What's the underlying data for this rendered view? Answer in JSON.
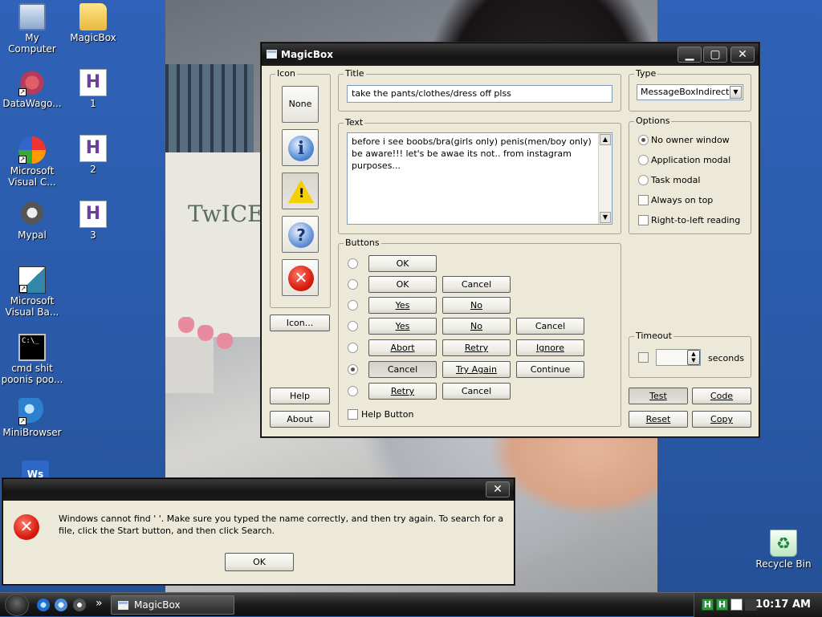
{
  "desktop": {
    "icons": [
      {
        "label": "My Computer"
      },
      {
        "label": "MagicBox"
      },
      {
        "label": "DataWago..."
      },
      {
        "label": "1"
      },
      {
        "label": "Microsoft Visual C..."
      },
      {
        "label": "2"
      },
      {
        "label": "Mypal"
      },
      {
        "label": "3"
      },
      {
        "label": "Microsoft Visual Ba..."
      },
      {
        "label": "cmd shit poonis poo..."
      },
      {
        "label": "MiniBrowser"
      },
      {
        "label": "Recycle Bin"
      }
    ],
    "glyphs": {
      "hfile": "H",
      "ws": "Ws",
      "cmd": "C:\\_",
      "recycle": "♻",
      "shortcut": "↗"
    },
    "wallpaper": {
      "board_text": "TwICE!"
    }
  },
  "magicbox": {
    "title": "MagicBox",
    "controls": {
      "minimize": "▁",
      "maximize": "▢",
      "close": "✕"
    },
    "icon_group": {
      "legend": "Icon",
      "none_label": "None",
      "info_glyph": "i",
      "warn_glyph": "!",
      "help_glyph": "?",
      "error_glyph": "✕",
      "icon_button": "Icon...",
      "help_button": "Help",
      "about_button": "About"
    },
    "title_group": {
      "legend": "Title",
      "value": "take the pants/clothes/dress off plss"
    },
    "text_group": {
      "legend": "Text",
      "value": "before i see boobs/bra(girls only) penis(men/boy only) be aware!!! let's be awae its not.. from instagram purposes..."
    },
    "scroll": {
      "up": "▲",
      "down": "▼"
    },
    "type_group": {
      "legend": "Type",
      "selected": "MessageBoxIndirect",
      "arrow": "▼"
    },
    "options_group": {
      "legend": "Options",
      "items": [
        {
          "label": "No owner window",
          "kind": "radio",
          "checked": true
        },
        {
          "label": "Application modal",
          "kind": "radio",
          "checked": false
        },
        {
          "label": "Task modal",
          "kind": "radio",
          "checked": false
        },
        {
          "label": "Always on top",
          "kind": "check",
          "checked": false
        },
        {
          "label": "Right-to-left reading",
          "kind": "check",
          "checked": false
        }
      ]
    },
    "buttons_group": {
      "legend": "Buttons",
      "rows": [
        {
          "buttons": [
            "OK"
          ],
          "selected": false
        },
        {
          "buttons": [
            "OK",
            "Cancel"
          ],
          "selected": false
        },
        {
          "buttons": [
            "Yes",
            "No"
          ],
          "selected": false
        },
        {
          "buttons": [
            "Yes",
            "No",
            "Cancel"
          ],
          "selected": false
        },
        {
          "buttons": [
            "Abort",
            "Retry",
            "Ignore"
          ],
          "selected": false
        },
        {
          "buttons": [
            "Cancel",
            "Try Again",
            "Continue"
          ],
          "selected": true
        },
        {
          "buttons": [
            "Retry",
            "Cancel"
          ],
          "selected": false
        }
      ],
      "help_button_label": "Help Button"
    },
    "timeout_group": {
      "legend": "Timeout",
      "seconds_label": "seconds",
      "value": ""
    },
    "actions": {
      "test": "Test",
      "code": "Code",
      "reset": "Reset",
      "copy": "Copy"
    }
  },
  "error_dialog": {
    "message": "Windows cannot find '    '. Make sure you typed the name correctly, and then try again. To search for a file, click the Start button, and then click Search.",
    "ok_label": "OK",
    "close": "✕",
    "icon_glyph": "✕"
  },
  "taskbar": {
    "chevron": "»",
    "task_label": "MagicBox",
    "tray_glyph": "H",
    "clock": "10:17 AM"
  }
}
